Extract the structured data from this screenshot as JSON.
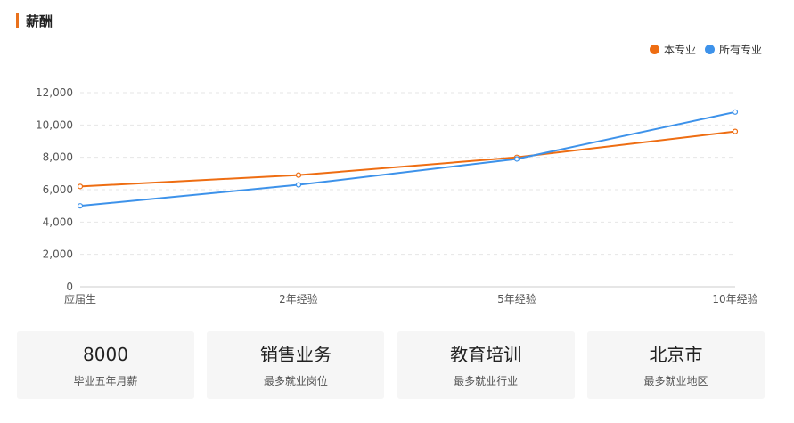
{
  "section": {
    "title": "薪酬"
  },
  "colors": {
    "accent": "#e9711c",
    "this_major": "#ee6d12",
    "all_majors": "#3d92ea"
  },
  "chart_data": {
    "type": "line",
    "categories": [
      "应届生",
      "2年经验",
      "5年经验",
      "10年经验"
    ],
    "series": [
      {
        "name": "本专业",
        "color": "#ee6d12",
        "values": [
          6200,
          6900,
          8000,
          9600
        ]
      },
      {
        "name": "所有专业",
        "color": "#3d92ea",
        "values": [
          5000,
          6300,
          7900,
          10800
        ]
      }
    ],
    "ylim": [
      0,
      12000
    ],
    "yticks": [
      0,
      2000,
      4000,
      6000,
      8000,
      10000,
      12000
    ],
    "ytick_labels": [
      "0",
      "2,000",
      "4,000",
      "6,000",
      "8,000",
      "10,000",
      "12,000"
    ],
    "grid": "horizontal dashed",
    "legend_position": "top-right"
  },
  "cards": [
    {
      "value": "8000",
      "label": "毕业五年月薪"
    },
    {
      "value": "销售业务",
      "label": "最多就业岗位"
    },
    {
      "value": "教育培训",
      "label": "最多就业行业"
    },
    {
      "value": "北京市",
      "label": "最多就业地区"
    }
  ]
}
